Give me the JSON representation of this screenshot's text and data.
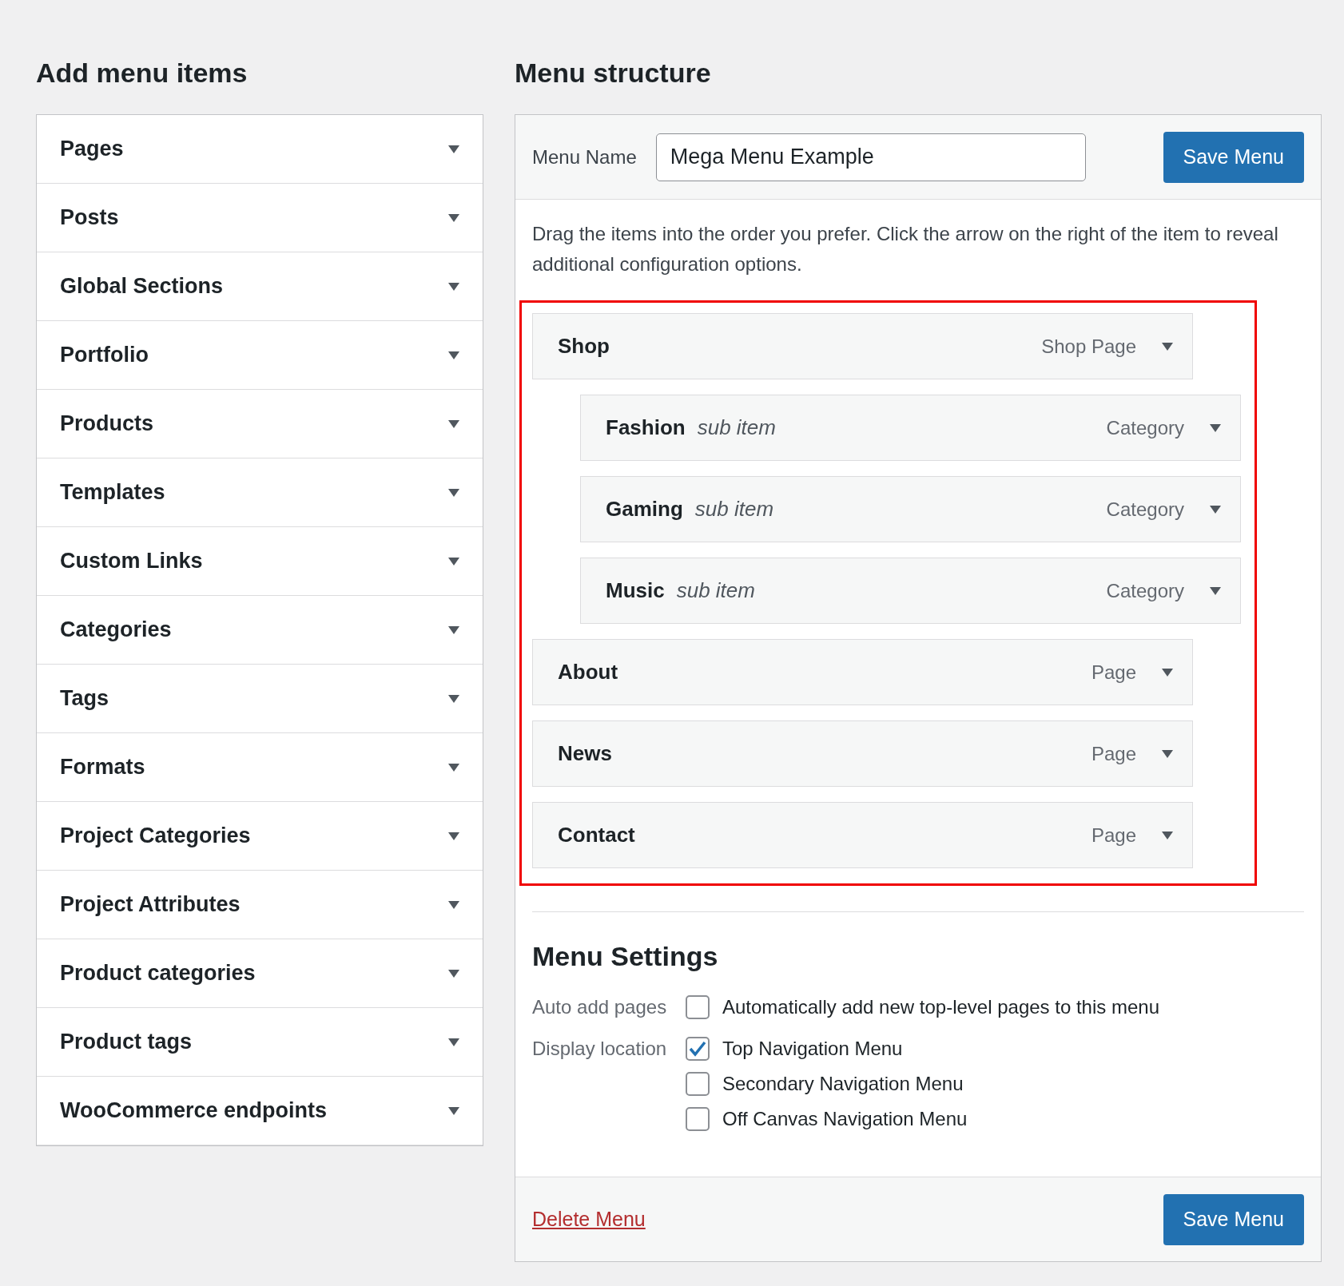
{
  "add_menu_items": {
    "title": "Add menu items",
    "sections": [
      {
        "label": "Pages"
      },
      {
        "label": "Posts"
      },
      {
        "label": "Global Sections"
      },
      {
        "label": "Portfolio"
      },
      {
        "label": "Products"
      },
      {
        "label": "Templates"
      },
      {
        "label": "Custom Links"
      },
      {
        "label": "Categories"
      },
      {
        "label": "Tags"
      },
      {
        "label": "Formats"
      },
      {
        "label": "Project Categories"
      },
      {
        "label": "Project Attributes"
      },
      {
        "label": "Product categories"
      },
      {
        "label": "Product tags"
      },
      {
        "label": "WooCommerce endpoints"
      }
    ]
  },
  "menu_structure": {
    "title": "Menu structure",
    "menu_name_label": "Menu Name",
    "menu_name_value": "Mega Menu Example",
    "save_button": "Save Menu",
    "instructions": "Drag the items into the order you prefer. Click the arrow on the right of the item to reveal additional configuration options.",
    "items": [
      {
        "title": "Shop",
        "type": "Shop Page",
        "children": [
          {
            "title": "Fashion",
            "note": "sub item",
            "type": "Category"
          },
          {
            "title": "Gaming",
            "note": "sub item",
            "type": "Category"
          },
          {
            "title": "Music",
            "note": "sub item",
            "type": "Category"
          }
        ]
      },
      {
        "title": "About",
        "type": "Page"
      },
      {
        "title": "News",
        "type": "Page"
      },
      {
        "title": "Contact",
        "type": "Page"
      }
    ],
    "settings": {
      "title": "Menu Settings",
      "groups": [
        {
          "label": "Auto add pages",
          "options": [
            {
              "label": "Automatically add new top-level pages to this menu",
              "checked": false
            }
          ]
        },
        {
          "label": "Display location",
          "options": [
            {
              "label": "Top Navigation Menu",
              "checked": true
            },
            {
              "label": "Secondary Navigation Menu",
              "checked": false
            },
            {
              "label": "Off Canvas Navigation Menu",
              "checked": false
            }
          ]
        }
      ]
    },
    "delete_link": "Delete Menu",
    "footer_save_button": "Save Menu"
  }
}
